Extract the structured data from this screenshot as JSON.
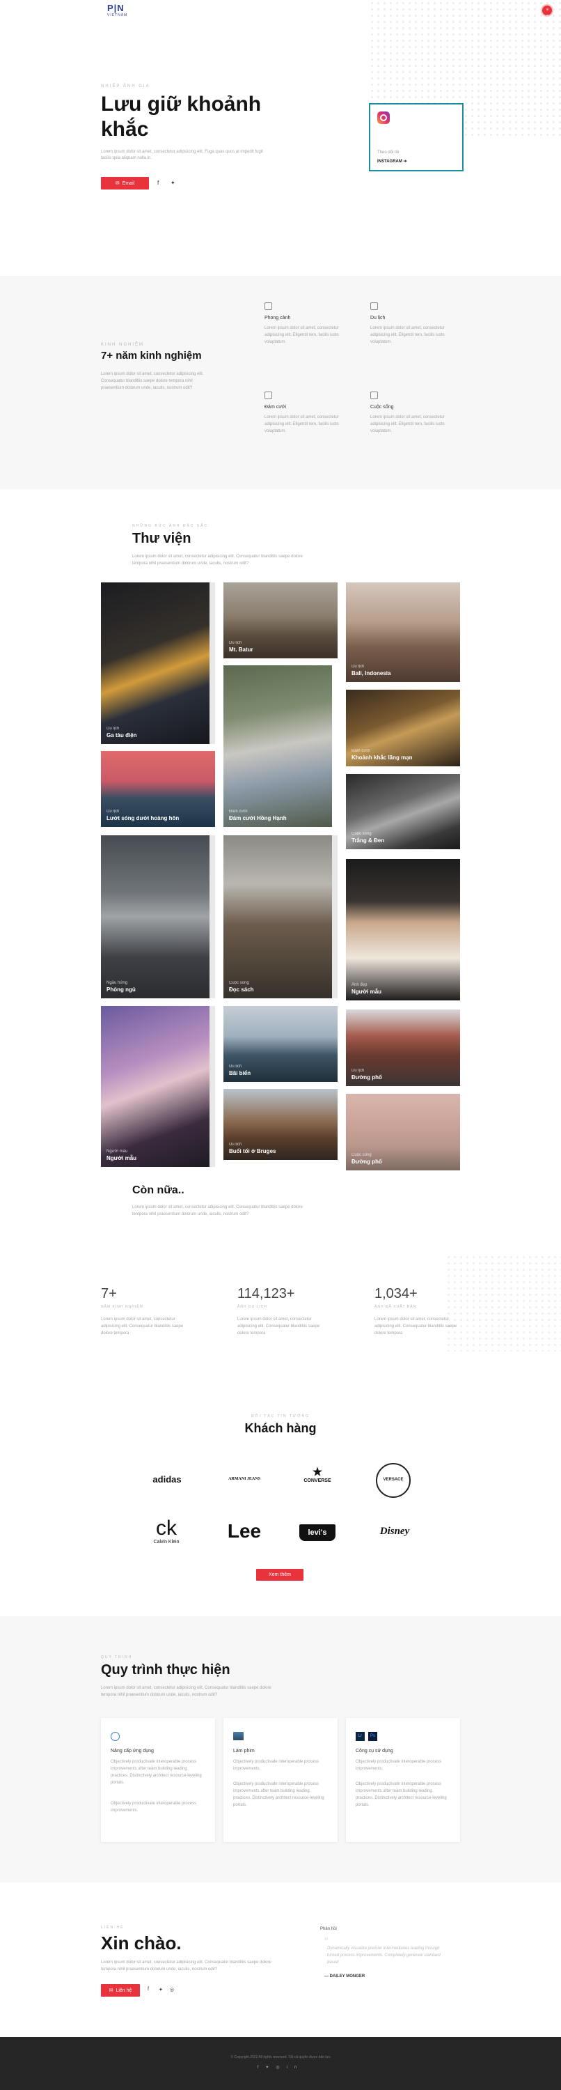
{
  "brand": {
    "logo_text": "P|N",
    "logo_sub": "VIETNAM"
  },
  "hero": {
    "eyebrow": "Nhiếp ảnh gia",
    "title_line1": "Lưu giữ khoảnh",
    "title_line2": "khắc",
    "text": "Lorem ipsum dolor sit amet, consectetur adipisicing elit. Fuga quas quos at impedit fugit facilis quia aliquam nulla in.",
    "email_button": "Email",
    "insta_label": "Theo dõi tôi",
    "insta_link": "INSTAGRAM"
  },
  "experience": {
    "eyebrow": "Kinh nghiệm",
    "title": "7+ năm kinh nghiệm",
    "text": "Lorem ipsum dolor sit amet, consectetur adipisicing elit. Consequatur blanditiis saepe dolore tempora nihil praesentium dolorum unde, iaculis, nostrum odit?",
    "features": [
      {
        "title": "Phong cảnh",
        "text": "Lorem ipsum dolor sit amet, consectetur adipisicing elit. Eligendi rem, facilis iusto voluptatum.",
        "icon": "landscape-icon"
      },
      {
        "title": "Du lịch",
        "text": "Lorem ipsum dolor sit amet, consectetur adipisicing elit. Eligendi rem, facilis iusto voluptatum.",
        "icon": "travel-icon"
      },
      {
        "title": "Đám cưới",
        "text": "Lorem ipsum dolor sit amet, consectetur adipisicing elit. Eligendi rem, facilis iusto voluptatum.",
        "icon": "wedding-icon"
      },
      {
        "title": "Cuộc sống",
        "text": "Lorem ipsum dolor sit amet, consectetur adipisicing elit. Eligendi rem, facilis iusto voluptatum.",
        "icon": "life-icon"
      }
    ]
  },
  "gallery": {
    "eyebrow": "Những bức ảnh đặc sắc",
    "title": "Thư viện",
    "text": "Lorem ipsum dolor sit amet, consectetur adipisicing elit. Consequatur blanditiis saepe dolore tempora nihil praesentium dolorum unde, iaculis, nostrum odit?",
    "items": [
      {
        "sub": "Du lịch",
        "title": "Ga tàu điện"
      },
      {
        "sub": "Du lịch",
        "title": "Lướt sóng dưới hoàng hôn"
      },
      {
        "sub": "Du lịch",
        "title": "Mt. Batur"
      },
      {
        "sub": "Đám cưới",
        "title": "Đám cưới Hồng Hạnh"
      },
      {
        "sub": "Du lịch",
        "title": "Bali, Indonesia"
      },
      {
        "sub": "Đám cưới",
        "title": "Khoảnh khắc lãng mạn"
      },
      {
        "sub": "Cuộc sống",
        "title": "Trắng & Đen"
      },
      {
        "sub": "Ngẫu hứng",
        "title": "Phòng ngủ"
      },
      {
        "sub": "Cuộc sống",
        "title": "Đọc sách"
      },
      {
        "sub": "Ảnh đẹp",
        "title": "Người mẫu"
      },
      {
        "sub": "Người mẫu",
        "title": "Người mẫu"
      },
      {
        "sub": "Du lịch",
        "title": "Bãi biển"
      },
      {
        "sub": "Du lịch",
        "title": "Đường phố"
      },
      {
        "sub": "Du lịch",
        "title": "Buổi tối ở Bruges"
      },
      {
        "sub": "Cuộc sống",
        "title": "Đường phố"
      }
    ],
    "more_title": "Còn nữa..",
    "more_text": "Lorem ipsum dolor sit amet, consectetur adipisicing elit. Consequatur blanditiis saepe dolore tempora nihil praesentium dolorum unde, iaculis, nostrum odit?"
  },
  "stats": [
    {
      "value": "7+",
      "label": "Năm kinh nghiệm",
      "text": "Lorem ipsum dolor sit amet, consectetur adipisicing elit. Consequatur blanditiis saepe dolore tempora"
    },
    {
      "value": "114,123+",
      "label": "Ảnh du lịch",
      "text": "Lorem ipsum dolor sit amet, consectetur adipisicing elit. Consequatur blanditiis saepe dolore tempora"
    },
    {
      "value": "1,034+",
      "label": "Ảnh đã xuất bản",
      "text": "Lorem ipsum dolor sit amet, consectetur adipisicing elit. Consequatur blanditiis saepe dolore tempora"
    }
  ],
  "clients": {
    "eyebrow": "Đối tác tin tưởng",
    "title": "Khách hàng",
    "logos": [
      "adidas",
      "ARMANI JEANS",
      "CONVERSE",
      "VERSACE",
      "Calvin Klein",
      "Lee",
      "levi's",
      "Disney"
    ],
    "button": "Xem thêm"
  },
  "process": {
    "eyebrow": "Quy trình",
    "title": "Quy trình thực hiện",
    "text": "Lorem ipsum dolor sit amet, consectetur adipisicing elit. Consequatur blanditiis saepe dolore tempora nihil praesentium dolorum unde, iaculis, nostrum odit?",
    "steps": [
      {
        "title": "Nâng cấp ứng dụng",
        "text1": "Objectively productivate interoperable process improvements after team building leading practices. Distinctively architect resource-leveling portals.",
        "text2": "Objectively productivate interoperable process improvements."
      },
      {
        "title": "Làm phim",
        "text1": "Objectively productivate interoperable process improvements.",
        "text2": "Objectively productivate interoperable process improvements after team building leading practices. Distinctively architect resource-leveling portals."
      },
      {
        "title": "Công cụ sử dụng",
        "text1": "Objectively productivate interoperable process improvements.",
        "text2": "Objectively productivate interoperable process improvements after team building leading practices. Distinctively architect resource-leveling portals."
      }
    ]
  },
  "contact": {
    "eyebrow": "Liên hệ",
    "title": "Xin chào.",
    "text": "Lorem ipsum dolor sit amet, consectetur adipisicing elit. Consequatur blanditiis saepe dolore tempora nihil praesentium dolorum unde, iaculis, nostrum odit?",
    "button": "Liên hệ",
    "quote_label": "Phản hồi",
    "quote": "Dynamically visualize premier intermediaries leading through turned process improvements. Completely generate standard based",
    "quote_author": "DAILEY MONGER"
  },
  "footer": {
    "copyright": "© Copyright 2021 All rights reserved. Tất cả quyền được bảo lưu"
  },
  "colors": {
    "accent": "#e8323c",
    "brand_blue": "#2c3e91",
    "insta_border": "#1d8f9a"
  }
}
